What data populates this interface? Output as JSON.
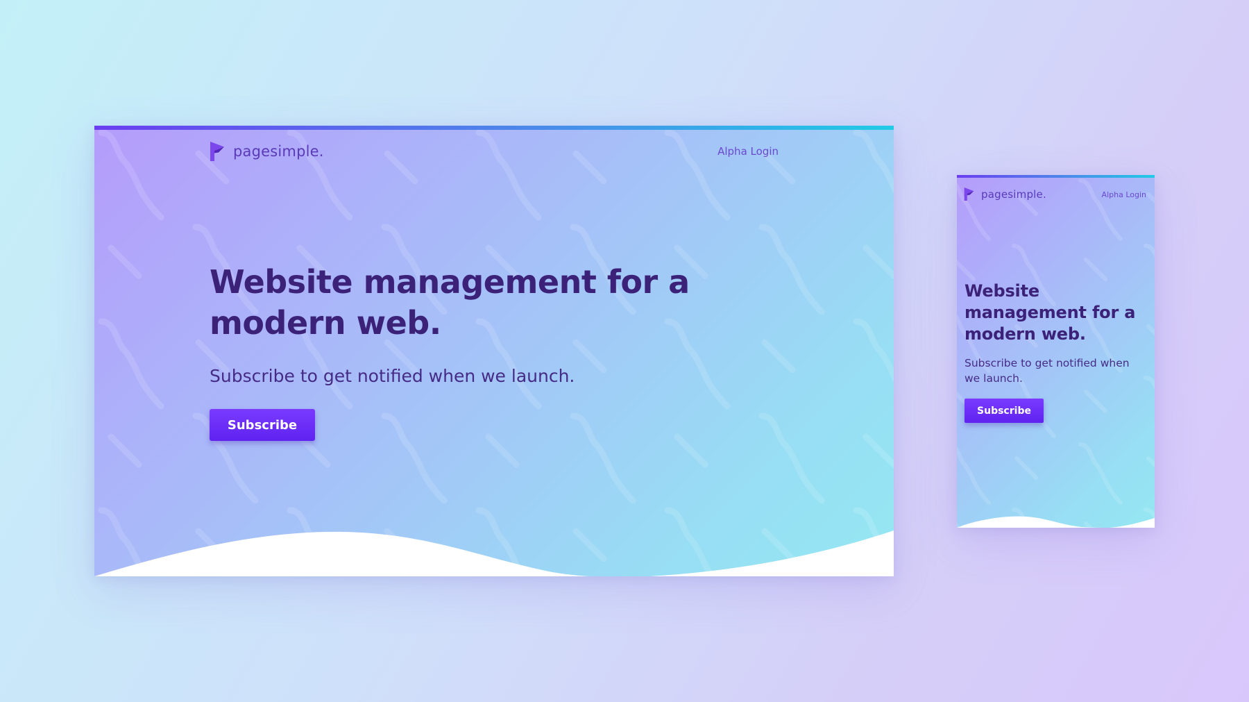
{
  "brand": {
    "name": "pagesimple.",
    "logo_icon": "pagesimple-flag-logo-icon"
  },
  "nav": {
    "login_label": "Alpha Login"
  },
  "hero": {
    "title": "Website management for a modern web.",
    "subtitle": "Subscribe to get notified when we launch.",
    "cta_label": "Subscribe"
  },
  "colors": {
    "brand_purple": "#5a3ab8",
    "heading": "#3b2178",
    "button": "#6a2cf8",
    "bar_start": "#6a3ef0",
    "bar_end": "#21cbe6"
  }
}
